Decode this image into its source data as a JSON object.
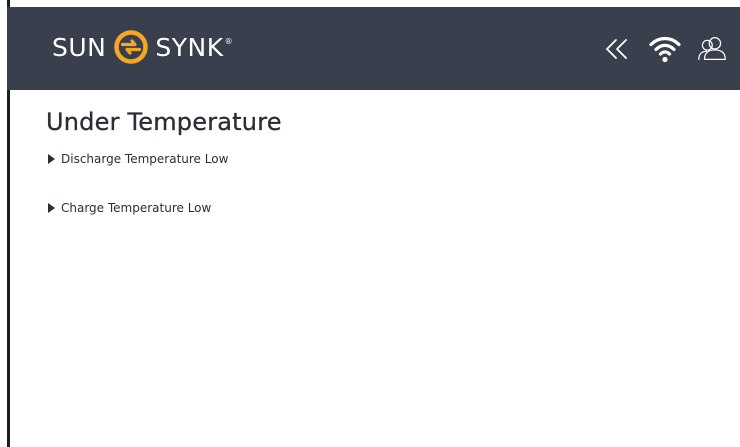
{
  "header": {
    "brand_left": "SUN",
    "brand_right": "SYNK",
    "brand_reg": "®",
    "brand_color": "#f5a623",
    "background": "#3a3f4d",
    "icons": [
      "collapse-icon",
      "wifi-icon",
      "user-icon"
    ]
  },
  "page": {
    "title": "Under Temperature",
    "items": [
      {
        "label": "Discharge Temperature Low",
        "icon": "caret-right-icon"
      },
      {
        "label": "Charge Temperature Low",
        "icon": "caret-right-icon"
      }
    ]
  }
}
